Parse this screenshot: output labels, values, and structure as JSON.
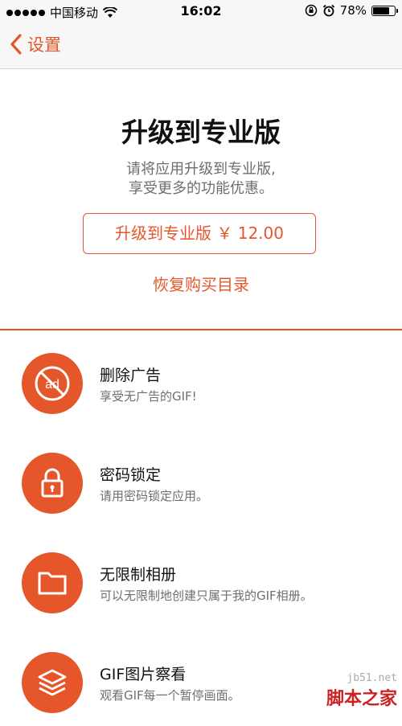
{
  "status_bar": {
    "carrier": "中国移动",
    "time": "16:02",
    "battery_percent": "78%",
    "battery_level": 0.78
  },
  "nav": {
    "back_label": "设置"
  },
  "upgrade": {
    "title": "升级到专业版",
    "description_line1": "请将应用升级到专业版,",
    "description_line2": "享受更多的功能优惠。",
    "buy_button": "升级到专业版 ￥ 12.00",
    "restore": "恢复购买目录"
  },
  "features": [
    {
      "title": "删除广告",
      "subtitle": "享受无广告的GIF!",
      "icon": "no-ads-icon"
    },
    {
      "title": "密码锁定",
      "subtitle": "请用密码锁定应用。",
      "icon": "lock-icon"
    },
    {
      "title": "无限制相册",
      "subtitle": "可以无限制地创建只属于我的GIF相册。",
      "icon": "folder-icon"
    },
    {
      "title": "GIF图片察看",
      "subtitle": "观看GIF每一个暂停画面。",
      "icon": "layers-icon"
    }
  ],
  "watermark": {
    "url": "jb51.net",
    "text": "脚本之家"
  },
  "colors": {
    "accent": "#e5572b",
    "secondary_text": "#6e6e6e",
    "bar_background": "#f7f7f7"
  }
}
